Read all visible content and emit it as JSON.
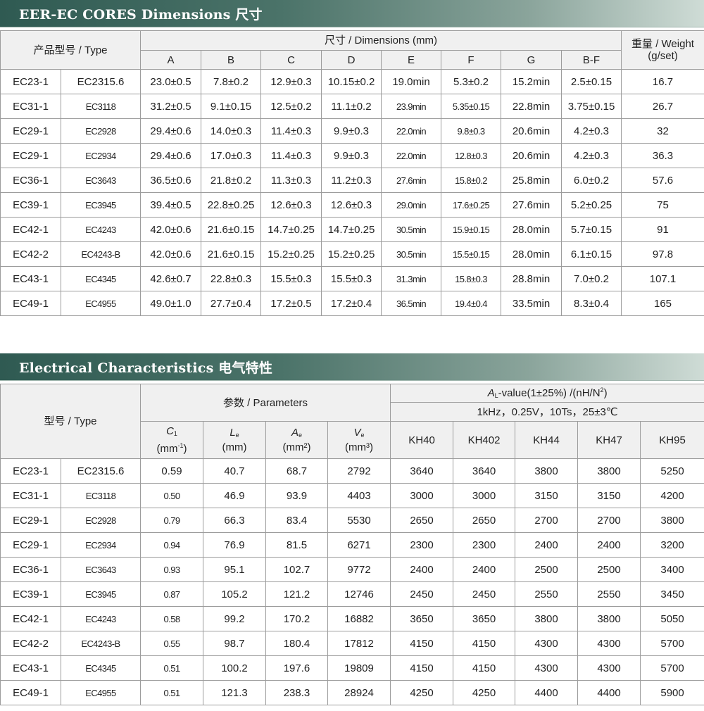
{
  "dim": {
    "title": "EER-EC CORES Dimensions   尺寸",
    "type_header": "产品型号 / Type",
    "dimensions_header": "尺寸 / Dimensions (mm)",
    "weight_header_1": "重量 / Weight",
    "weight_header_2": "(g/set)",
    "columns": [
      "A",
      "B",
      "C",
      "D",
      "E",
      "F",
      "G",
      "B-F"
    ],
    "rows": [
      [
        "EC23-1",
        "EC2315.6",
        "23.0±0.5",
        "7.8±0.2",
        "12.9±0.3",
        "10.15±0.2",
        "19.0min",
        "5.3±0.2",
        "15.2min",
        "2.5±0.15",
        "16.7"
      ],
      [
        "EC31-1",
        "EC3118",
        "31.2±0.5",
        "9.1±0.15",
        "12.5±0.2",
        "11.1±0.2",
        "23.9min",
        "5.35±0.15",
        "22.8min",
        "3.75±0.15",
        "26.7"
      ],
      [
        "EC29-1",
        "EC2928",
        "29.4±0.6",
        "14.0±0.3",
        "11.4±0.3",
        "9.9±0.3",
        "22.0min",
        "9.8±0.3",
        "20.6min",
        "4.2±0.3",
        "32"
      ],
      [
        "EC29-1",
        "EC2934",
        "29.4±0.6",
        "17.0±0.3",
        "11.4±0.3",
        "9.9±0.3",
        "22.0min",
        "12.8±0.3",
        "20.6min",
        "4.2±0.3",
        "36.3"
      ],
      [
        "EC36-1",
        "EC3643",
        "36.5±0.6",
        "21.8±0.2",
        "11.3±0.3",
        "11.2±0.3",
        "27.6min",
        "15.8±0.2",
        "25.8min",
        "6.0±0.2",
        "57.6"
      ],
      [
        "EC39-1",
        "EC3945",
        "39.4±0.5",
        "22.8±0.25",
        "12.6±0.3",
        "12.6±0.3",
        "29.0min",
        "17.6±0.25",
        "27.6min",
        "5.2±0.25",
        "75"
      ],
      [
        "EC42-1",
        "EC4243",
        "42.0±0.6",
        "21.6±0.15",
        "14.7±0.25",
        "14.7±0.25",
        "30.5min",
        "15.9±0.15",
        "28.0min",
        "5.7±0.15",
        "91"
      ],
      [
        "EC42-2",
        "EC4243-B",
        "42.0±0.6",
        "21.6±0.15",
        "15.2±0.25",
        "15.2±0.25",
        "30.5min",
        "15.5±0.15",
        "28.0min",
        "6.1±0.15",
        "97.8"
      ],
      [
        "EC43-1",
        "EC4345",
        "42.6±0.7",
        "22.8±0.3",
        "15.5±0.3",
        "15.5±0.3",
        "31.3min",
        "15.8±0.3",
        "28.8min",
        "7.0±0.2",
        "107.1"
      ],
      [
        "EC49-1",
        "EC4955",
        "49.0±1.0",
        "27.7±0.4",
        "17.2±0.5",
        "17.2±0.4",
        "36.5min",
        "19.4±0.4",
        "33.5min",
        "8.3±0.4",
        "165"
      ]
    ]
  },
  "elec": {
    "title": "Electrical Characteristics 电气特性",
    "type_header": "型号 / Type",
    "params_header": "参数 / Parameters",
    "al_letter": "A",
    "al_sub": "L",
    "al_rest": "-value(1±25%) /(nH/N",
    "al_sup": "2",
    "al_close": ")",
    "conditions": "1kHz，0.25V，10Ts，25±3℃",
    "params": [
      {
        "letter": "C",
        "sub": "1",
        "unit_open": "(mm",
        "unit_sup": "-1",
        "unit_close": ")"
      },
      {
        "letter": "L",
        "sub": "e",
        "unit": "(mm)"
      },
      {
        "letter": "A",
        "sub": "e",
        "unit": "(mm²)"
      },
      {
        "letter": "V",
        "sub": "e",
        "unit": "(mm³)"
      }
    ],
    "materials": [
      "KH40",
      "KH402",
      "KH44",
      "KH47",
      "KH95"
    ],
    "rows": [
      [
        "EC23-1",
        "EC2315.6",
        "0.59",
        "40.7",
        "68.7",
        "2792",
        "3640",
        "3640",
        "3800",
        "3800",
        "5250"
      ],
      [
        "EC31-1",
        "EC3118",
        "0.50",
        "46.9",
        "93.9",
        "4403",
        "3000",
        "3000",
        "3150",
        "3150",
        "4200"
      ],
      [
        "EC29-1",
        "EC2928",
        "0.79",
        "66.3",
        "83.4",
        "5530",
        "2650",
        "2650",
        "2700",
        "2700",
        "3800"
      ],
      [
        "EC29-1",
        "EC2934",
        "0.94",
        "76.9",
        "81.5",
        "6271",
        "2300",
        "2300",
        "2400",
        "2400",
        "3200"
      ],
      [
        "EC36-1",
        "EC3643",
        "0.93",
        "95.1",
        "102.7",
        "9772",
        "2400",
        "2400",
        "2500",
        "2500",
        "3400"
      ],
      [
        "EC39-1",
        "EC3945",
        "0.87",
        "105.2",
        "121.2",
        "12746",
        "2450",
        "2450",
        "2550",
        "2550",
        "3450"
      ],
      [
        "EC42-1",
        "EC4243",
        "0.58",
        "99.2",
        "170.2",
        "16882",
        "3650",
        "3650",
        "3800",
        "3800",
        "5050"
      ],
      [
        "EC42-2",
        "EC4243-B",
        "0.55",
        "98.7",
        "180.4",
        "17812",
        "4150",
        "4150",
        "4300",
        "4300",
        "5700"
      ],
      [
        "EC43-1",
        "EC4345",
        "0.51",
        "100.2",
        "197.6",
        "19809",
        "4150",
        "4150",
        "4300",
        "4300",
        "5700"
      ],
      [
        "EC49-1",
        "EC4955",
        "0.51",
        "121.3",
        "238.3",
        "28924",
        "4250",
        "4250",
        "4400",
        "4400",
        "5900"
      ]
    ]
  }
}
